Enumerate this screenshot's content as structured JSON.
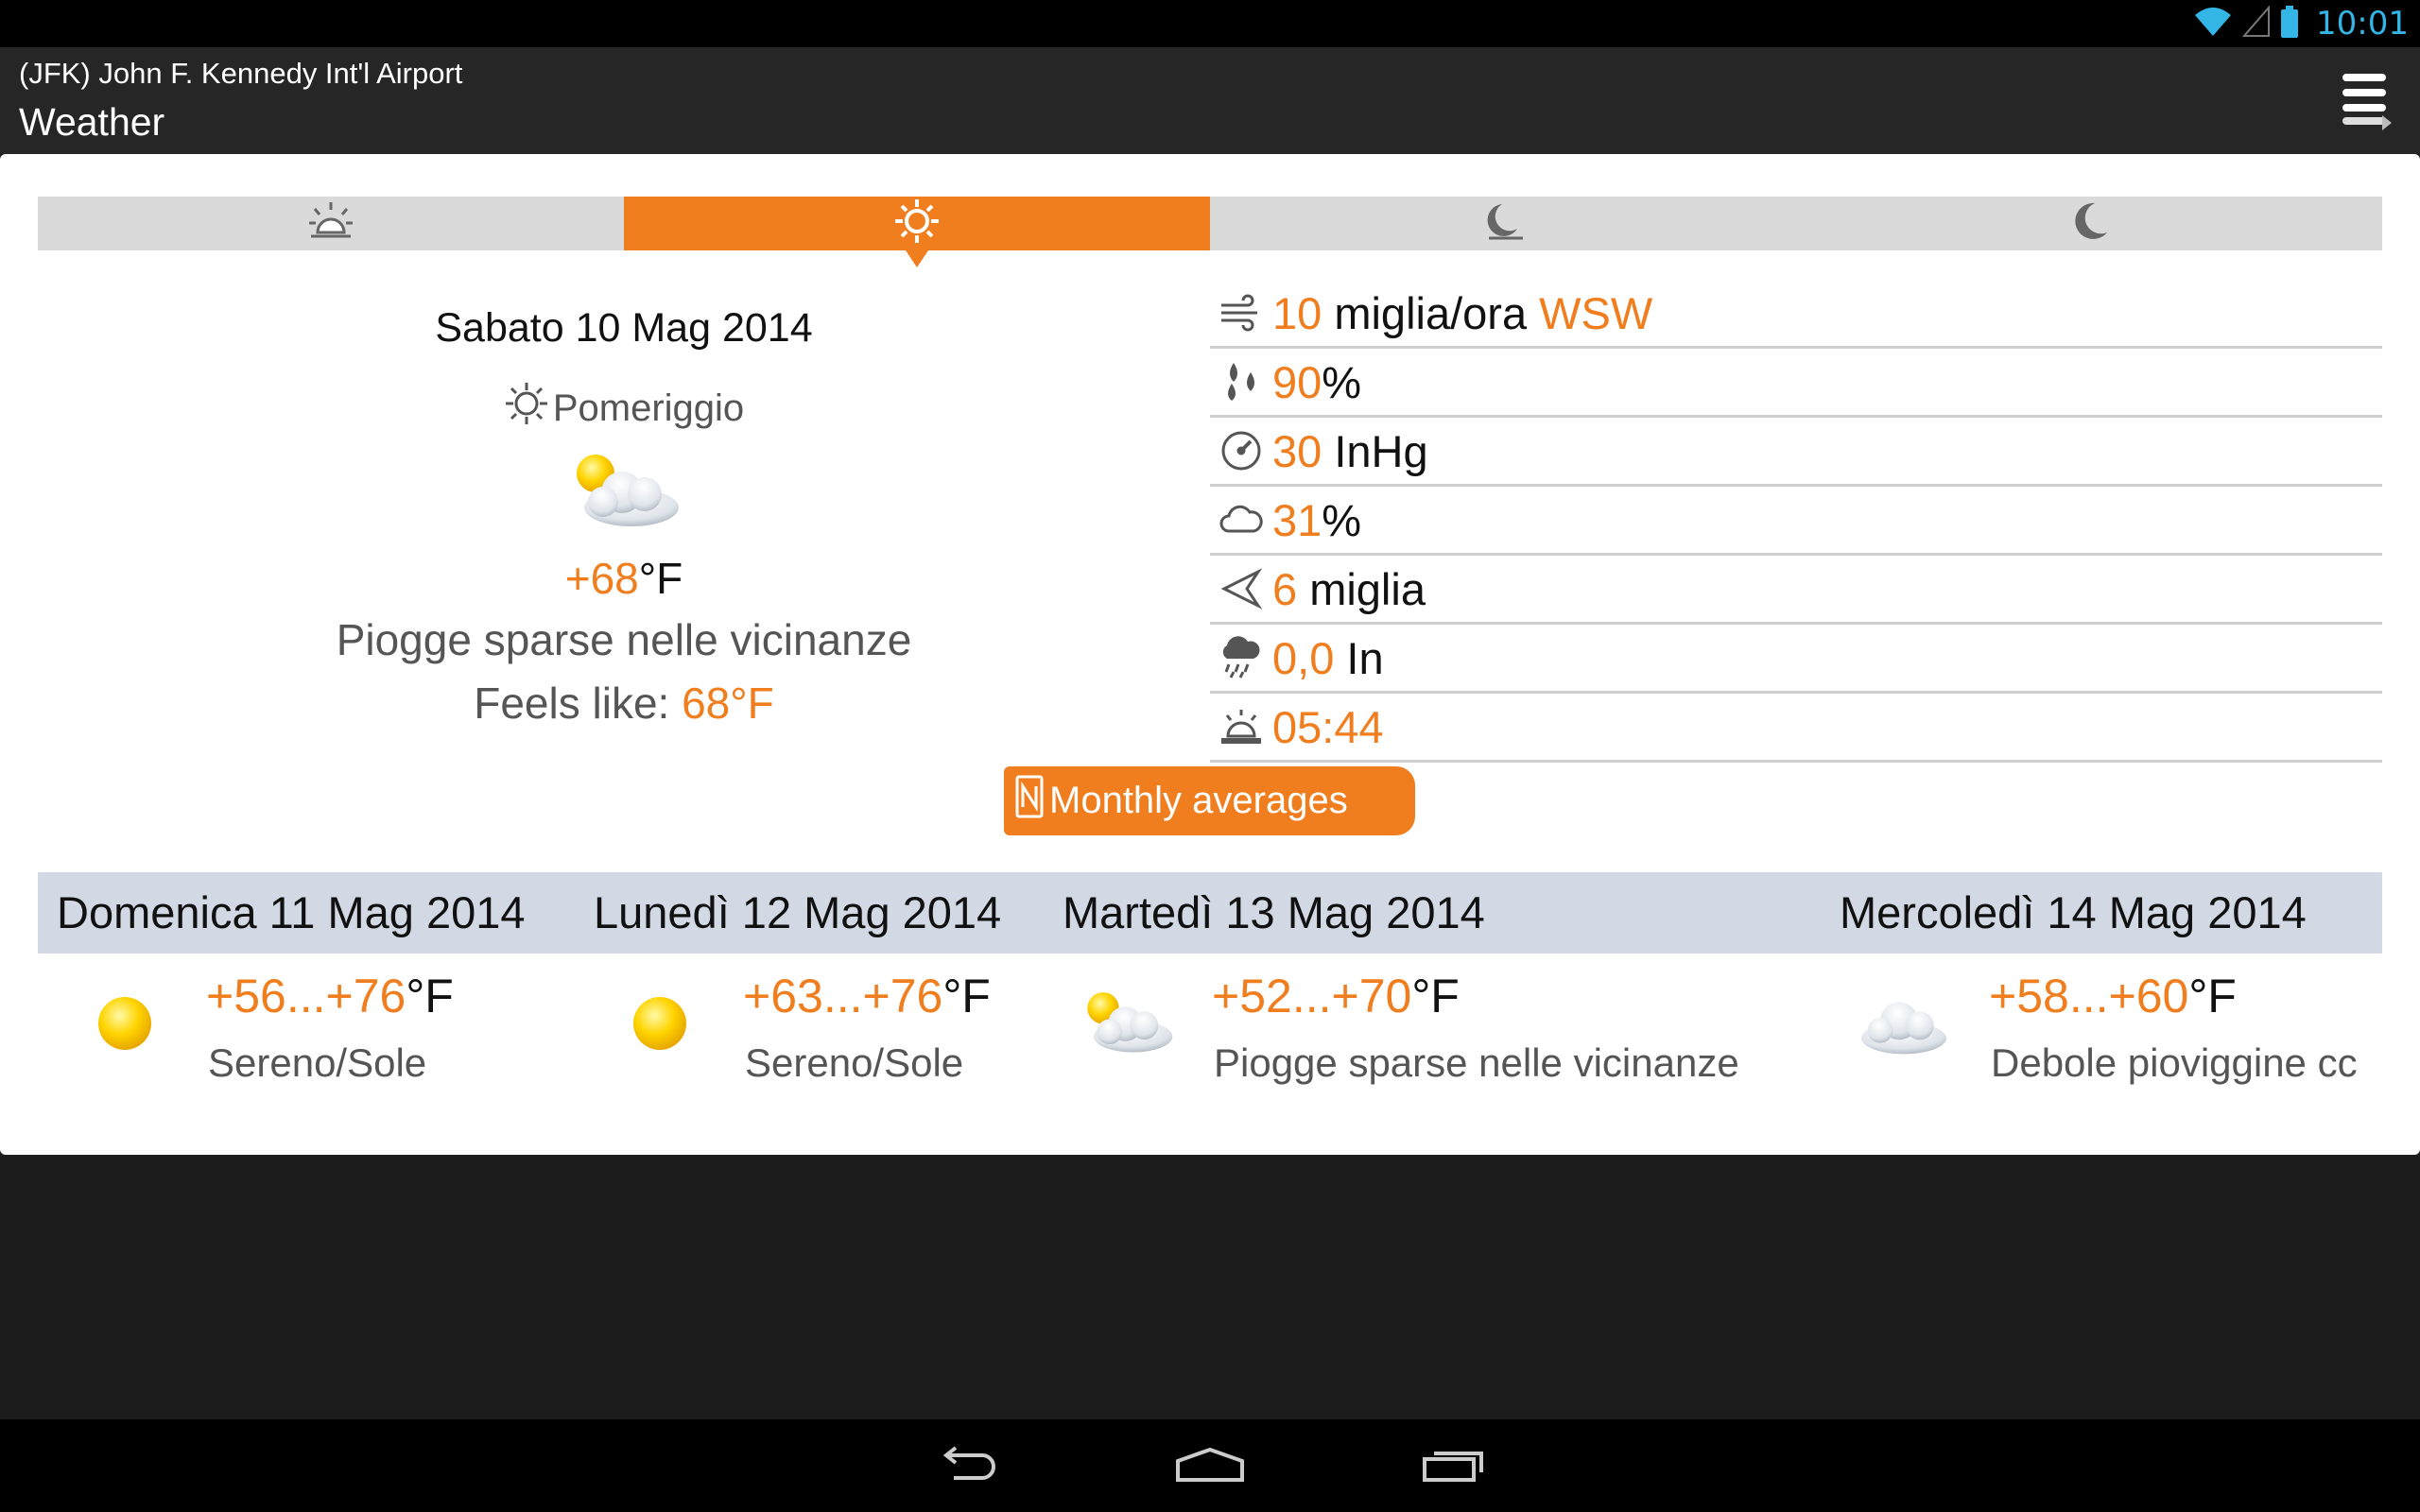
{
  "status_bar": {
    "time": "10:01",
    "icons": [
      "wifi-icon",
      "signal-icon",
      "battery-icon"
    ]
  },
  "action_bar": {
    "subtitle": "(JFK) John F. Kennedy Int'l Airport",
    "title": "Weather",
    "menu_icon": "overflow-menu-icon"
  },
  "tabs": [
    {
      "icon": "sunrise-icon",
      "active": false
    },
    {
      "icon": "sun-icon",
      "active": true
    },
    {
      "icon": "moonset-icon",
      "active": false
    },
    {
      "icon": "moon-icon",
      "active": false
    }
  ],
  "current": {
    "date": "Sabato 10 Mag 2014",
    "period": "Pomeriggio",
    "icon": "partly-cloudy-icon",
    "temp_value": "+68",
    "temp_unit": "°F",
    "description": "Piogge sparse nelle vicinanze",
    "feels_label": "Feels like: ",
    "feels_value": "68",
    "feels_unit": "°F"
  },
  "details": [
    {
      "icon": "wind-icon",
      "value": "10",
      "unit": " miglia/ora ",
      "extra": "WSW"
    },
    {
      "icon": "humidity-icon",
      "value": "90",
      "unit": "%",
      "extra": ""
    },
    {
      "icon": "pressure-icon",
      "value": "30",
      "unit": " InHg",
      "extra": ""
    },
    {
      "icon": "cloud-cover-icon",
      "value": "31",
      "unit": "%",
      "extra": ""
    },
    {
      "icon": "visibility-icon",
      "value": "6",
      "unit": " miglia",
      "extra": ""
    },
    {
      "icon": "precipitation-icon",
      "value": "0,0",
      "unit": " In",
      "extra": ""
    },
    {
      "icon": "sunrise-time-icon",
      "value": "05:44",
      "unit": "",
      "extra": ""
    }
  ],
  "monthly_button": {
    "label": "Monthly averages",
    "icon": "calendar-icon"
  },
  "forecast": [
    {
      "day": "Domenica 11 Mag 2014",
      "icon": "sun-icon",
      "temp_range": "+56...+76",
      "unit": "°F",
      "description": "Sereno/Sole"
    },
    {
      "day": "Lunedì 12 Mag 2014",
      "icon": "sun-icon",
      "temp_range": "+63...+76",
      "unit": "°F",
      "description": "Sereno/Sole"
    },
    {
      "day": "Martedì 13 Mag 2014",
      "icon": "partly-cloudy-icon",
      "temp_range": "+52...+70",
      "unit": "°F",
      "description": "Piogge sparse nelle vicinanze"
    },
    {
      "day": "Mercoledì 14 Mag 2014",
      "icon": "cloud-icon",
      "temp_range": "+58...+60",
      "unit": "°F",
      "description": "Debole pioviggine cc"
    }
  ],
  "nav_bar": {
    "icons": [
      "back-icon",
      "home-icon",
      "recent-apps-icon"
    ]
  },
  "colors": {
    "accent": "#f07e1e",
    "status_time": "#33b5e5",
    "forecast_header": "#d2d8e4"
  }
}
